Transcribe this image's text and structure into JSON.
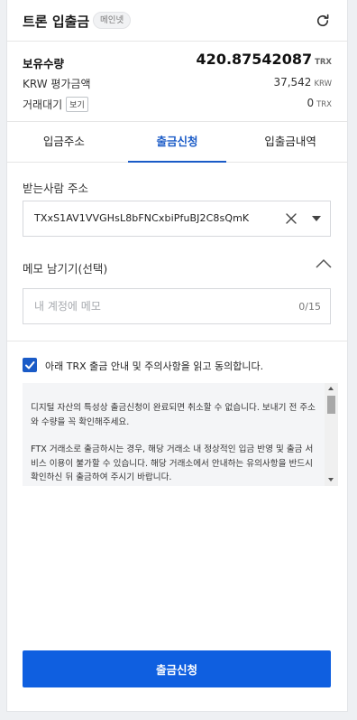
{
  "header": {
    "title": "트론 입출금",
    "network_badge": "메인넷",
    "refresh_icon": "refresh-icon"
  },
  "summary": {
    "holdings_label": "보유수량",
    "holdings_value": "420.87542087",
    "holdings_unit": "TRX",
    "krw_label": "KRW 평가금액",
    "krw_value": "37,542",
    "krw_unit": "KRW",
    "pending_label": "거래대기",
    "view_button": "보기",
    "pending_value": "0",
    "pending_unit": "TRX"
  },
  "tabs": [
    {
      "label": "입금주소",
      "active": false
    },
    {
      "label": "출금신청",
      "active": true
    },
    {
      "label": "입출금내역",
      "active": false
    }
  ],
  "form": {
    "recipient_label": "받는사람 주소",
    "recipient_address": "TXxS1AV1VVGHsL8bFNCxbiPfuBJ2C8sQmK",
    "memo_label": "메모 남기기(선택)",
    "memo_placeholder": "내 계정에 메모",
    "memo_value": "",
    "memo_count": "0/15"
  },
  "agreement": {
    "checked": true,
    "text": "아래 TRX 출금 안내 및 주의사항을 읽고 동의합니다."
  },
  "notice": {
    "paragraphs": [
      "디지털 자산의 특성상 출금신청이 완료되면 취소할 수 없습니다. 보내기 전 주소와 수량을 꼭 확인해주세요.",
      "FTX 거래소로 출금하시는 경우, 해당 거래소 내 정상적인 입금 반영 및 출금 서비스 이용이 불가할 수 있습니다. 해당 거래소에서 안내하는 유의사항을 반드시 확인하신 뒤 출금하여 주시기 바랍니다."
    ]
  },
  "submit": {
    "label": "출금신청"
  },
  "colors": {
    "accent": "#1a5bc7",
    "button": "#0f5fe0"
  }
}
